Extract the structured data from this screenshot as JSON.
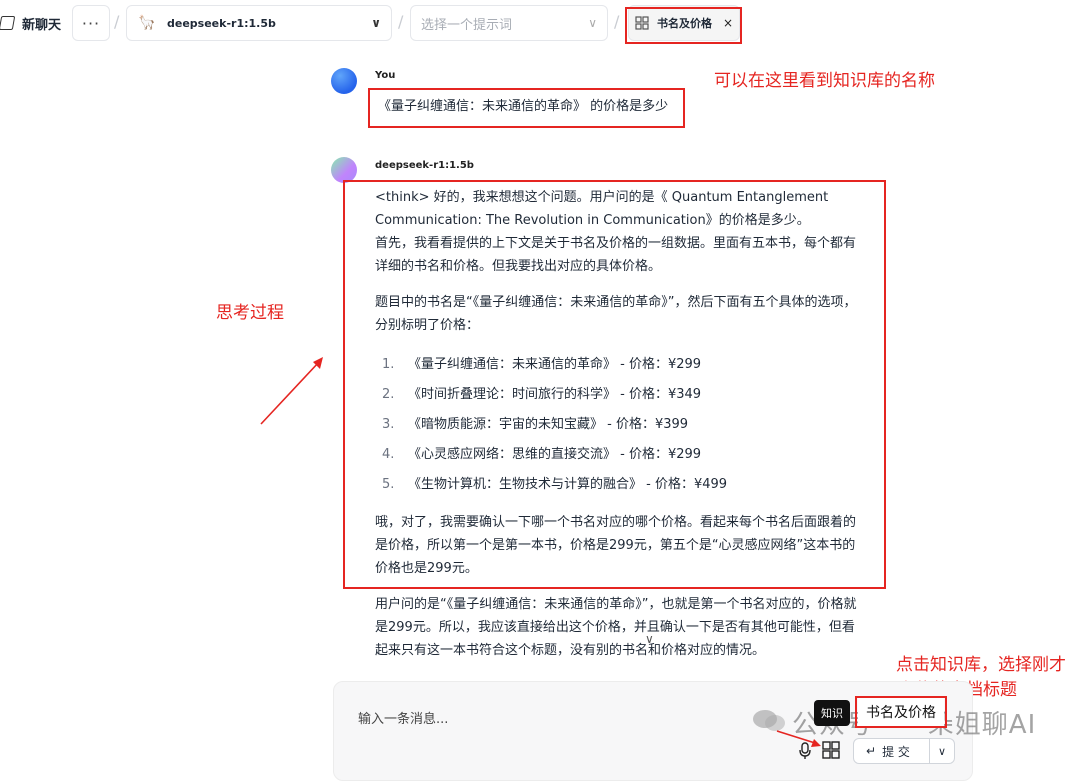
{
  "topbar": {
    "new_chat_label": "新聊天",
    "more_label": "···",
    "model_name": "deepseek-r1:1.5b",
    "prompt_placeholder": "选择一个提示词",
    "knowledge_tab_label": "书名及价格",
    "close_label": "×"
  },
  "messages": {
    "user": {
      "sender": "You",
      "text": "《量子纠缠通信：未来通信的革命》 的价格是多少"
    },
    "assistant": {
      "sender": "deepseek-r1:1.5b",
      "think_p1": "<think> 好的，我来想想这个问题。用户问的是《 Quantum Entanglement Communication: The Revolution in Communication》的价格是多少。",
      "think_p2": "首先，我看看提供的上下文是关于书名及价格的一组数据。里面有五本书，每个都有详细的书名和价格。但我要找出对应的具体价格。",
      "think_p3": "题目中的书名是“《量子纠缠通信：未来通信的革命》”，然后下面有五个具体的选项，分别标明了价格：",
      "books": [
        {
          "num": "1.",
          "text": "《量子纠缠通信：未来通信的革命》 - 价格：¥299"
        },
        {
          "num": "2.",
          "text": "《时间折叠理论：时间旅行的科学》 - 价格：¥349"
        },
        {
          "num": "3.",
          "text": "《暗物质能源：宇宙的未知宝藏》 - 价格：¥399"
        },
        {
          "num": "4.",
          "text": "《心灵感应网络：思维的直接交流》 - 价格：¥299"
        },
        {
          "num": "5.",
          "text": "《生物计算机：生物技术与计算的融合》 - 价格：¥499"
        }
      ],
      "think_p4": "哦，对了，我需要确认一下哪一个书名对应的哪个价格。看起来每个书名后面跟着的是价格，所以第一个是第一本书，价格是299元，第五个是“心灵感应网络”这本书的价格也是299元。",
      "answer_p1": "用户问的是“《量子纠缠通信：未来通信的革命》”，也就是第一个书名对应的，价格就是299元。所以，我应该直接给出这个价格，并且确认一下是否有其他可能性，但看起来只有这一本书符合这个标题，没有别的书名和价格对应的情况。"
    }
  },
  "annotations": {
    "knowledge_name": "可以在这里看到知识库的名称",
    "thinking": "思考过程",
    "click_kb_line1": "点击知识库，选择刚才",
    "click_kb_line2": "上传的文档标题"
  },
  "input": {
    "placeholder": "输入一条消息...",
    "tooltip": "知识",
    "kb_chip": "书名及价格",
    "submit_label": "提 交"
  },
  "watermark": "公众号 · 一朵姐聊AI",
  "colors": {
    "annotation_red": "#e52521",
    "user_avatar": "#2563eb"
  }
}
